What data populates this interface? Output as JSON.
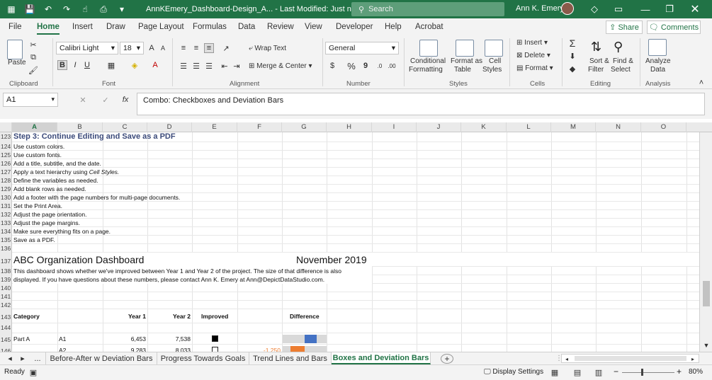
{
  "titlebar": {
    "filename": "AnnKEmery_Dashboard-Design_A...",
    "status": "Last Modified: Just now",
    "search_placeholder": "Search",
    "user": "Ann K. Emery"
  },
  "menu": {
    "items": [
      "File",
      "Home",
      "Insert",
      "Draw",
      "Page Layout",
      "Formulas",
      "Data",
      "Review",
      "View",
      "Developer",
      "Help",
      "Acrobat"
    ],
    "active": "Home",
    "share": "Share",
    "comments": "Comments"
  },
  "ribbon": {
    "clipboard": {
      "label": "Clipboard",
      "paste": "Paste"
    },
    "font": {
      "label": "Font",
      "name": "Calibri Light",
      "size": "18"
    },
    "alignment": {
      "label": "Alignment",
      "wrap": "Wrap Text",
      "merge": "Merge & Center"
    },
    "number": {
      "label": "Number",
      "format": "General"
    },
    "styles": {
      "label": "Styles",
      "conditional": [
        "Conditional",
        "Formatting"
      ],
      "table": [
        "Format as",
        "Table"
      ],
      "cell": [
        "Cell",
        "Styles"
      ]
    },
    "cells": {
      "label": "Cells",
      "insert": "Insert",
      "delete": "Delete",
      "format": "Format"
    },
    "editing": {
      "label": "Editing",
      "sort": [
        "Sort &",
        "Filter"
      ],
      "find": [
        "Find &",
        "Select"
      ]
    },
    "analysis": {
      "label": "Analysis",
      "analyze": [
        "Analyze",
        "Data"
      ]
    }
  },
  "formula": {
    "namebox": "A1",
    "content": "Combo: Checkboxes and Deviation Bars"
  },
  "columns": [
    "A",
    "B",
    "C",
    "D",
    "E",
    "F",
    "G",
    "H",
    "I",
    "J",
    "K",
    "L",
    "M",
    "N",
    "O"
  ],
  "rows": [
    {
      "n": "123",
      "a": "Step 3: Continue Editing and Save as a PDF",
      "style": "heading"
    },
    {
      "n": "124",
      "a": "Use custom colors."
    },
    {
      "n": "125",
      "a": "Use custom fonts."
    },
    {
      "n": "126",
      "a": "Add a title, subtitle, and the date."
    },
    {
      "n": "127",
      "a": "Apply a text hierarchy using ",
      "a_it": "Cell Styles."
    },
    {
      "n": "128",
      "a": "Define the variables as needed."
    },
    {
      "n": "129",
      "a": "Add blank rows as needed."
    },
    {
      "n": "130",
      "a": "Add a footer with the page numbers for multi-page documents."
    },
    {
      "n": "131",
      "a": "Set the Print Area."
    },
    {
      "n": "132",
      "a": "Adjust the page orientation."
    },
    {
      "n": "133",
      "a": "Adjust the page margins."
    },
    {
      "n": "134",
      "a": "Make sure everything fits on a page."
    },
    {
      "n": "135",
      "a": "Save as a PDF."
    },
    {
      "n": "136",
      "a": ""
    }
  ],
  "dashboard": {
    "title_row": "137",
    "title": "ABC Organization Dashboard",
    "date": "November 2019",
    "desc_rows": [
      "138",
      "139"
    ],
    "desc_line1": "This dashboard shows whether we've improved between Year 1 and Year 2 of the project. The size of that difference is also",
    "desc_line2": "displayed. If you have questions about these numbers, please contact Ann K. Emery at Ann@DepictDataStudio.com.",
    "blank_rows": [
      "140",
      "141",
      "142"
    ],
    "header_row": "143",
    "headers": {
      "category": "Category",
      "year1": "Year 1",
      "year2": "Year 2",
      "improved": "Improved",
      "difference": "Difference"
    },
    "blank_row_2": "144",
    "data_rows": [
      {
        "n": "145",
        "category": "Part A",
        "item": "A1",
        "year1": "6,453",
        "year2": "7,538",
        "improved": true,
        "diff_label": "",
        "diff": 1085,
        "color": "#4472c4"
      },
      {
        "n": "146",
        "category": "",
        "item": "A2",
        "year1": "9,283",
        "year2": "8,033",
        "improved": false,
        "diff_label": "-1,250",
        "diff": -1250,
        "color": "#ed7d31"
      }
    ]
  },
  "sheet_tabs": {
    "more": "...",
    "tabs": [
      "Before-After w Deviation Bars",
      "Progress Towards Goals",
      "Trend Lines and Bars",
      "Boxes and Deviation Bars"
    ],
    "active": "Boxes and Deviation Bars"
  },
  "status": {
    "ready": "Ready",
    "display": "Display Settings",
    "zoom": "80%"
  }
}
